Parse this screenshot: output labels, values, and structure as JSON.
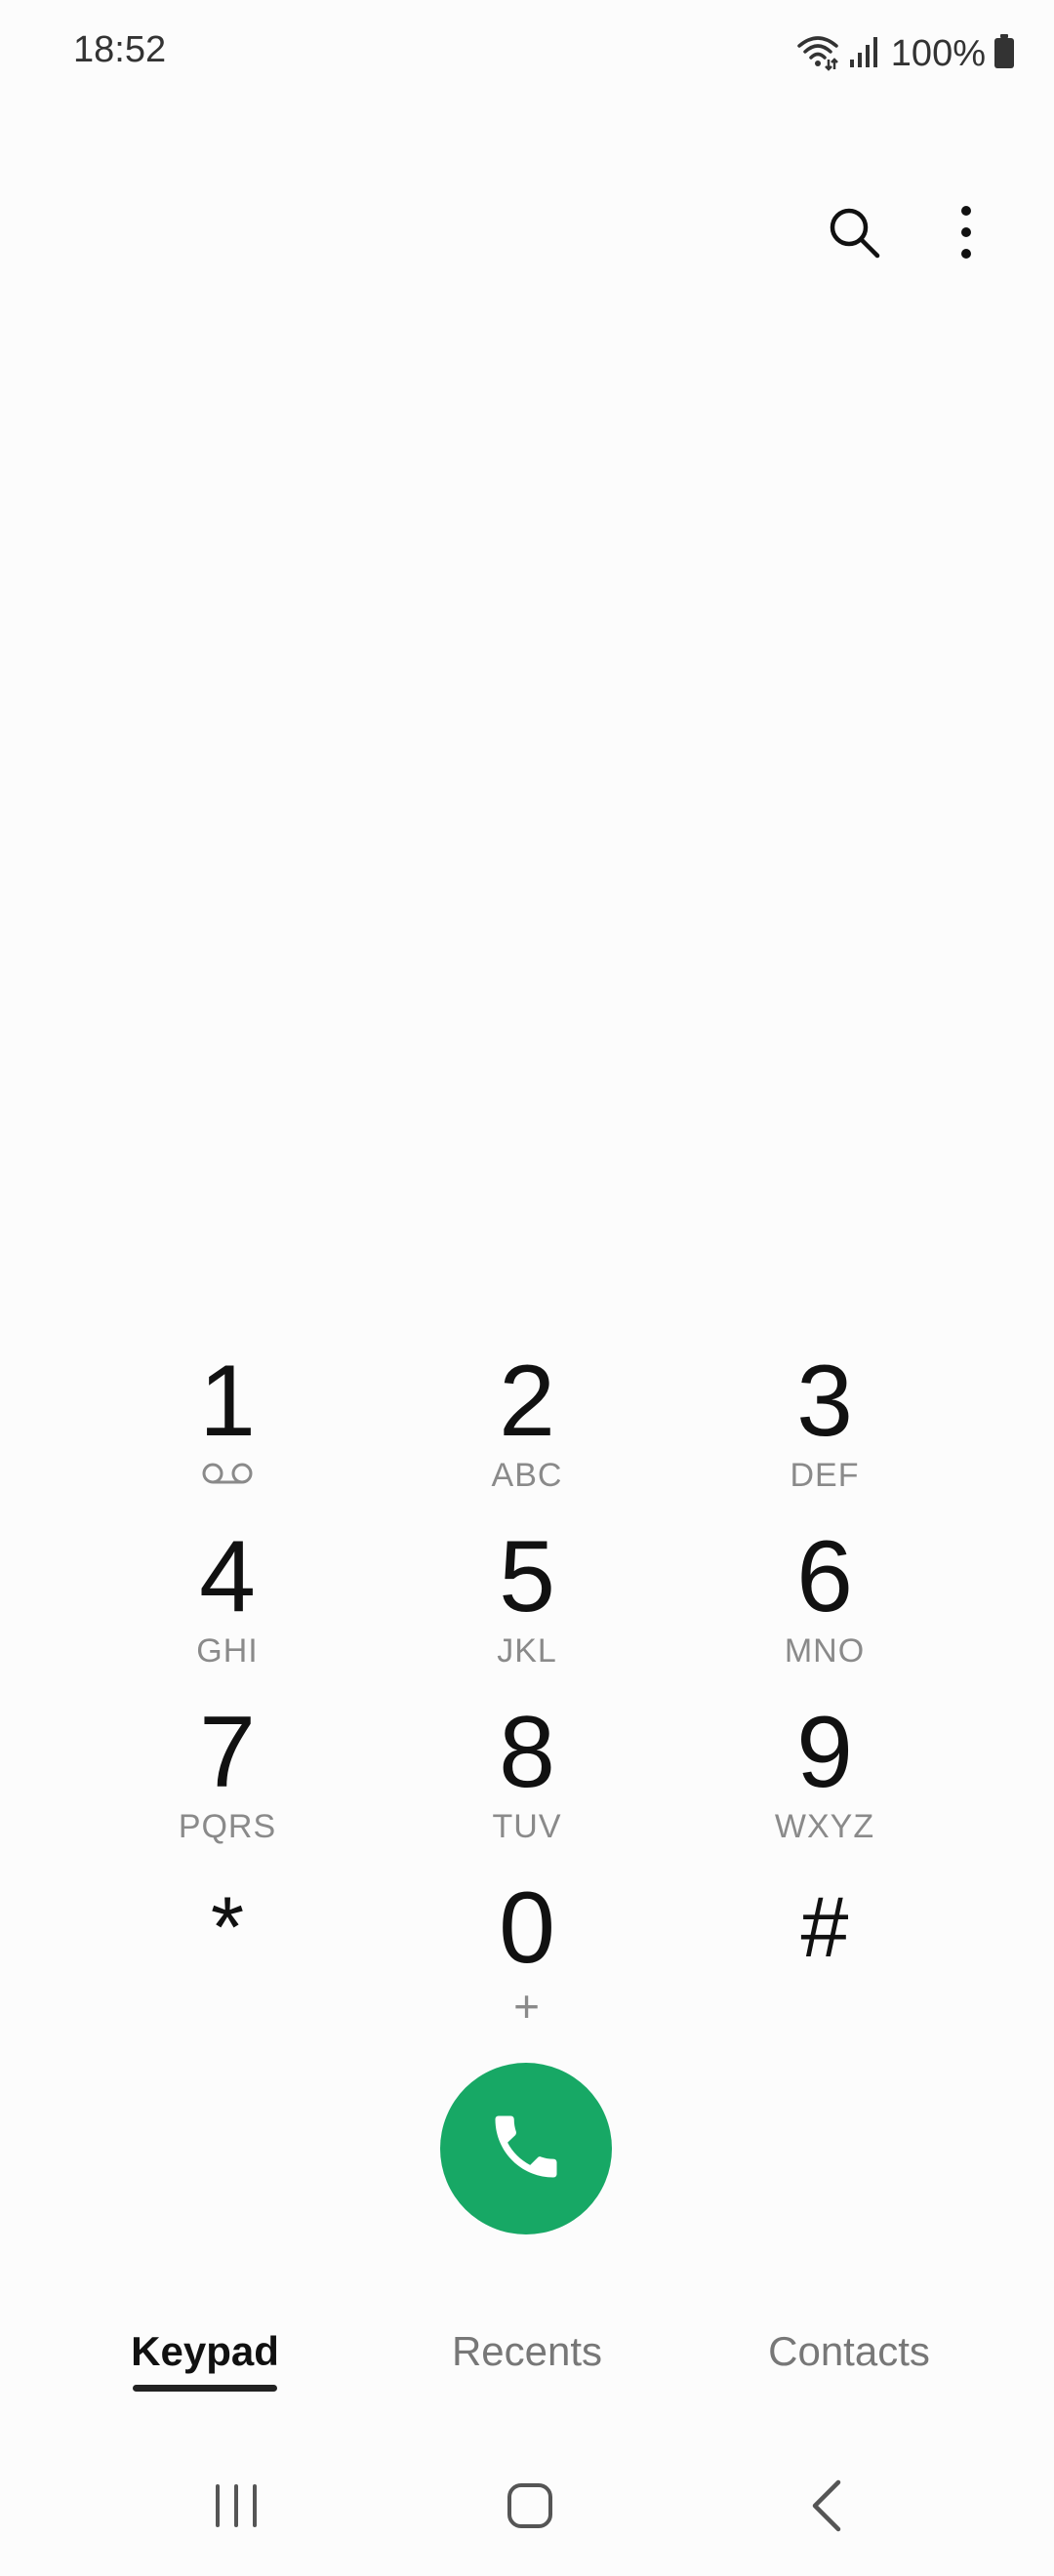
{
  "status_bar": {
    "time": "18:52",
    "battery": "100%",
    "icons": [
      "wifi-icon",
      "signal-icon",
      "battery-icon"
    ]
  },
  "top_actions": {
    "icons": [
      "search-icon",
      "more-vert-icon"
    ]
  },
  "keypad": {
    "keys": [
      {
        "digit": "1",
        "letters": "",
        "icon": "voicemail-icon"
      },
      {
        "digit": "2",
        "letters": "ABC"
      },
      {
        "digit": "3",
        "letters": "DEF"
      },
      {
        "digit": "4",
        "letters": "GHI"
      },
      {
        "digit": "5",
        "letters": "JKL"
      },
      {
        "digit": "6",
        "letters": "MNO"
      },
      {
        "digit": "7",
        "letters": "PQRS"
      },
      {
        "digit": "8",
        "letters": "TUV"
      },
      {
        "digit": "9",
        "letters": "WXYZ"
      },
      {
        "digit": "*",
        "letters": ""
      },
      {
        "digit": "0",
        "letters": "+"
      },
      {
        "digit": "#",
        "letters": ""
      }
    ]
  },
  "call_button": {
    "icon": "phone-icon",
    "color": "#17a865"
  },
  "tabs": [
    {
      "label": "Keypad",
      "active": true
    },
    {
      "label": "Recents",
      "active": false
    },
    {
      "label": "Contacts",
      "active": false
    }
  ],
  "nav_bar": {
    "icons": [
      "recents-icon",
      "home-icon",
      "back-icon"
    ]
  }
}
